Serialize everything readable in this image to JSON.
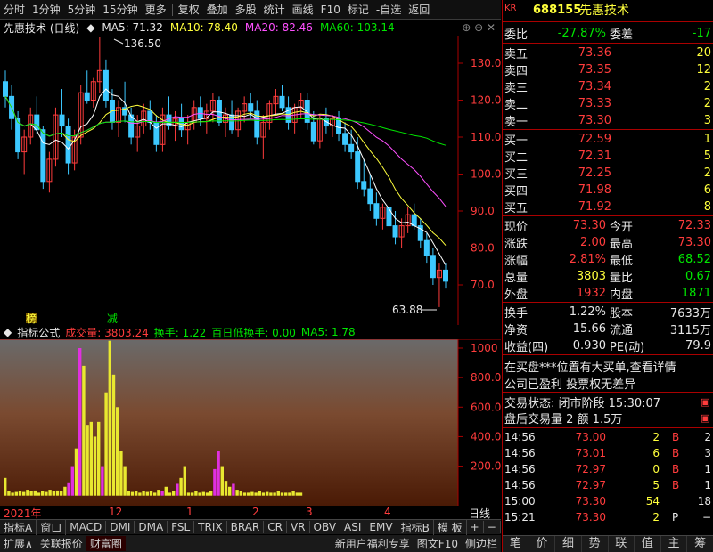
{
  "toolbar": {
    "items": [
      "分时",
      "1分钟",
      "5分钟",
      "15分钟",
      "更多",
      "复权",
      "叠加",
      "多股",
      "统计",
      "画线",
      "F10",
      "标记",
      "-自选",
      "返回"
    ]
  },
  "chart_header": {
    "title": "先惠技术 (日线)",
    "ma5": "MA5: 71.32",
    "ma10": "MA10: 78.40",
    "ma20": "MA20: 82.46",
    "ma60": "MA60: 103.14"
  },
  "price_axis": [
    "130.0",
    "120.0",
    "110.0",
    "100.0",
    "90.0",
    "80.0",
    "70.0"
  ],
  "annotations": {
    "high": "136.50",
    "low": "63.88",
    "mark1": "榜",
    "mark2": "减"
  },
  "volume_header": {
    "name": "指标公式",
    "volume": "成交量: 3803.24",
    "turnover": "换手: 1.22",
    "low_turnover": "百日低换手: 0.00",
    "ma5": "MA5: 1.78"
  },
  "volume_axis": [
    "1000",
    "800.0",
    "600.0",
    "400.0",
    "200.0"
  ],
  "date_axis": {
    "year": "2021年",
    "labels": [
      "12",
      "1",
      "2",
      "3",
      "4"
    ],
    "period": "日线"
  },
  "tabs1": [
    "指标A",
    "窗口",
    "MACD",
    "DMI",
    "DMA",
    "FSL",
    "TRIX",
    "BRAR",
    "CR",
    "VR",
    "OBV",
    "ASI",
    "EMV",
    "指标B",
    "模 板",
    "+",
    "−"
  ],
  "tabs2": {
    "left": [
      "扩展∧",
      "关联报价",
      "财富圈"
    ],
    "right": [
      "新用户福利专享",
      "图文F10",
      "侧边栏"
    ]
  },
  "quote": {
    "code": "688155",
    "name": "先惠技术",
    "badge": "KR",
    "weibi_label": "委比",
    "weibi": "-27.87%",
    "weicha_label": "委差",
    "weicha": "-17",
    "asks": [
      {
        "label": "卖五",
        "price": "73.36",
        "vol": "20"
      },
      {
        "label": "卖四",
        "price": "73.35",
        "vol": "12"
      },
      {
        "label": "卖三",
        "price": "73.34",
        "vol": "2"
      },
      {
        "label": "卖二",
        "price": "73.33",
        "vol": "2"
      },
      {
        "label": "卖一",
        "price": "73.30",
        "vol": "3"
      }
    ],
    "bids": [
      {
        "label": "买一",
        "price": "72.59",
        "vol": "1"
      },
      {
        "label": "买二",
        "price": "72.31",
        "vol": "5"
      },
      {
        "label": "买三",
        "price": "72.25",
        "vol": "2"
      },
      {
        "label": "买四",
        "price": "71.98",
        "vol": "6"
      },
      {
        "label": "买五",
        "price": "71.92",
        "vol": "8"
      }
    ],
    "stats1": [
      {
        "l1": "现价",
        "v1": "73.30",
        "c1": "red",
        "l2": "今开",
        "v2": "72.33",
        "c2": "red"
      },
      {
        "l1": "涨跌",
        "v1": "2.00",
        "c1": "red",
        "l2": "最高",
        "v2": "73.30",
        "c2": "red"
      },
      {
        "l1": "涨幅",
        "v1": "2.81%",
        "c1": "red",
        "l2": "最低",
        "v2": "68.52",
        "c2": "green"
      },
      {
        "l1": "总量",
        "v1": "3803",
        "c1": "yellow",
        "l2": "量比",
        "v2": "0.67",
        "c2": "green"
      },
      {
        "l1": "外盘",
        "v1": "1932",
        "c1": "red",
        "l2": "内盘",
        "v2": "1871",
        "c2": "green"
      }
    ],
    "stats2": [
      {
        "l1": "换手",
        "v1": "1.22%",
        "l2": "股本",
        "v2": "7633万"
      },
      {
        "l1": "净资",
        "v1": "15.66",
        "l2": "流通",
        "v2": "3115万"
      },
      {
        "l1": "收益(四)",
        "v1": "0.930",
        "l2": "PE(动)",
        "v2": "79.9"
      }
    ],
    "news1": "在买盘***位置有大买单,查看详情",
    "news2": "公司已盈利 投票权无差异",
    "status": "交易状态: 闭市阶段 15:30:07",
    "after_hours": "盘后交易量 2 额 1.5万",
    "ticks": [
      {
        "time": "14:56",
        "price": "73.00",
        "vol": "2",
        "bs": "B",
        "n": "2"
      },
      {
        "time": "14:56",
        "price": "73.01",
        "vol": "6",
        "bs": "B",
        "n": "3"
      },
      {
        "time": "14:56",
        "price": "72.97",
        "vol": "0",
        "bs": "B",
        "n": "1"
      },
      {
        "time": "14:56",
        "price": "72.97",
        "vol": "5",
        "bs": "B",
        "n": "1"
      },
      {
        "time": "15:00",
        "price": "73.30",
        "vol": "54",
        "bs": "",
        "n": "18"
      },
      {
        "time": "15:21",
        "price": "73.30",
        "vol": "2",
        "bs": "P",
        "n": "−"
      }
    ],
    "bottom_tabs": [
      "笔",
      "价",
      "细",
      "势",
      "联",
      "值",
      "主",
      "筹"
    ]
  },
  "colors": {
    "up": "#ff3c3c",
    "down": "#3cc8ff",
    "ma5": "#ffffff",
    "ma10": "#ffff3c",
    "ma20": "#ff50ff",
    "ma60": "#00e600",
    "vol": "#e8e830",
    "vol_alt": "#e030e0"
  }
}
